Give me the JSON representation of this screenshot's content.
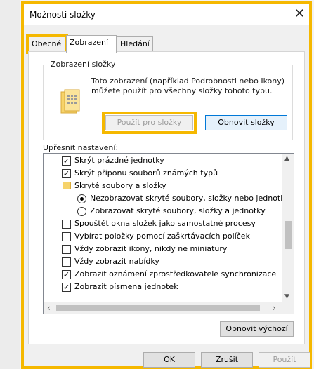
{
  "window": {
    "title": "Možnosti složky",
    "close": "✕"
  },
  "tabs": [
    {
      "label": "Obecné"
    },
    {
      "label": "Zobrazení"
    },
    {
      "label": "Hledání"
    }
  ],
  "folder_view": {
    "group_title": "Zobrazení složky",
    "description": "Toto zobrazení (například Podrobnosti nebo Ikony) můžete použít pro všechny složky tohoto typu.",
    "apply_button": "Použít pro složky",
    "reset_button": "Obnovit složky"
  },
  "advanced": {
    "label": "Upřesnit nastavení:",
    "items": [
      {
        "type": "checkbox",
        "checked": true,
        "label": "Skrýt prázdné jednotky"
      },
      {
        "type": "checkbox",
        "checked": true,
        "label": "Skrýt příponu souborů známých typů"
      },
      {
        "type": "folder",
        "label": "Skryté soubory a složky"
      },
      {
        "type": "radio",
        "checked": true,
        "label": "Nezobrazovat skryté soubory, složky nebo jednotky"
      },
      {
        "type": "radio",
        "checked": false,
        "label": "Zobrazovat skryté soubory, složky a jednotky"
      },
      {
        "type": "checkbox",
        "checked": false,
        "label": "Spouštět okna složek jako samostatné procesy"
      },
      {
        "type": "checkbox",
        "checked": false,
        "label": "Vybírat položky pomocí zaškrtávacích políček"
      },
      {
        "type": "checkbox",
        "checked": false,
        "label": "Vždy zobrazit ikony, nikdy ne miniatury"
      },
      {
        "type": "checkbox",
        "checked": false,
        "label": "Vždy zobrazit nabídky"
      },
      {
        "type": "checkbox",
        "checked": true,
        "label": "Zobrazit oznámení zprostředkovatele synchronizace"
      },
      {
        "type": "checkbox",
        "checked": true,
        "label": "Zobrazit písmena jednotek"
      }
    ],
    "defaults_button": "Obnovit výchozí"
  },
  "footer": {
    "ok": "OK",
    "cancel": "Zrušit",
    "apply": "Použít"
  },
  "colors": {
    "highlight": "#f5b800",
    "focus_border": "#0078d7"
  },
  "icons": {
    "close": "close-icon",
    "folder": "folder-icon",
    "tree_folder": "folder-small-icon",
    "scroll_up": "▲",
    "scroll_down": "▼",
    "scroll_left": "‹",
    "scroll_right": "›",
    "check": "✓"
  }
}
